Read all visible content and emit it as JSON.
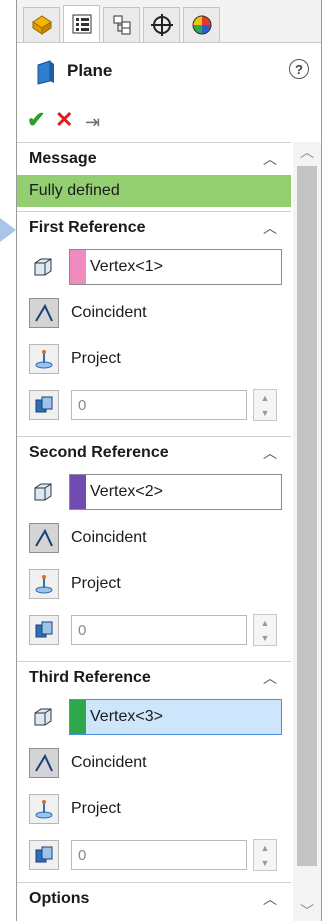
{
  "colors": {
    "message_bg": "#93cf71",
    "ref1": "#f08cbd",
    "ref2": "#6f4bb2",
    "ref3": "#2ea84a",
    "ok": "#2e9e2e",
    "cancel": "#e31b1b",
    "active_field": "#cde6fb"
  },
  "tabs": [
    {
      "icon": "feature-manager-icon"
    },
    {
      "icon": "property-manager-icon"
    },
    {
      "icon": "configuration-manager-icon"
    },
    {
      "icon": "dimxpert-manager-icon"
    },
    {
      "icon": "display-manager-icon"
    }
  ],
  "header": {
    "title": "Plane",
    "help_label": "?"
  },
  "message": {
    "title": "Message",
    "text": "Fully defined"
  },
  "references": [
    {
      "title": "First Reference",
      "value": "Vertex<1>",
      "constraint": "Coincident",
      "project": "Project",
      "count": "0"
    },
    {
      "title": "Second Reference",
      "value": "Vertex<2>",
      "constraint": "Coincident",
      "project": "Project",
      "count": "0"
    },
    {
      "title": "Third Reference",
      "value": "Vertex<3>",
      "constraint": "Coincident",
      "project": "Project",
      "count": "0"
    }
  ],
  "options": {
    "title": "Options"
  }
}
